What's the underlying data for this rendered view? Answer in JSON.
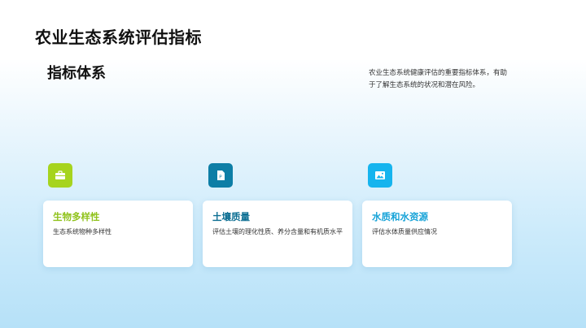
{
  "page": {
    "title": "农业生态系统评估指标",
    "subtitle": "指标体系",
    "description": "农业生态系统健康评估的重要指标体系，有助于了解生态系统的状况和潜在风险。"
  },
  "cards": [
    {
      "title": "生物多样性",
      "text": "生态系统物种多样性",
      "icon": "briefcase-icon",
      "accent": "#a6d41e",
      "title_color": "#8fc21a"
    },
    {
      "title": "土壤质量",
      "text": "评估土壤的理化性质、养分含量和有机质水平",
      "icon": "document-icon",
      "accent": "#0d7ea6",
      "title_color": "#0d6f93"
    },
    {
      "title": "水质和水资源",
      "text": "评估水体质量供应情况",
      "icon": "image-icon",
      "accent": "#16b4ee",
      "title_color": "#16a3d8"
    }
  ]
}
